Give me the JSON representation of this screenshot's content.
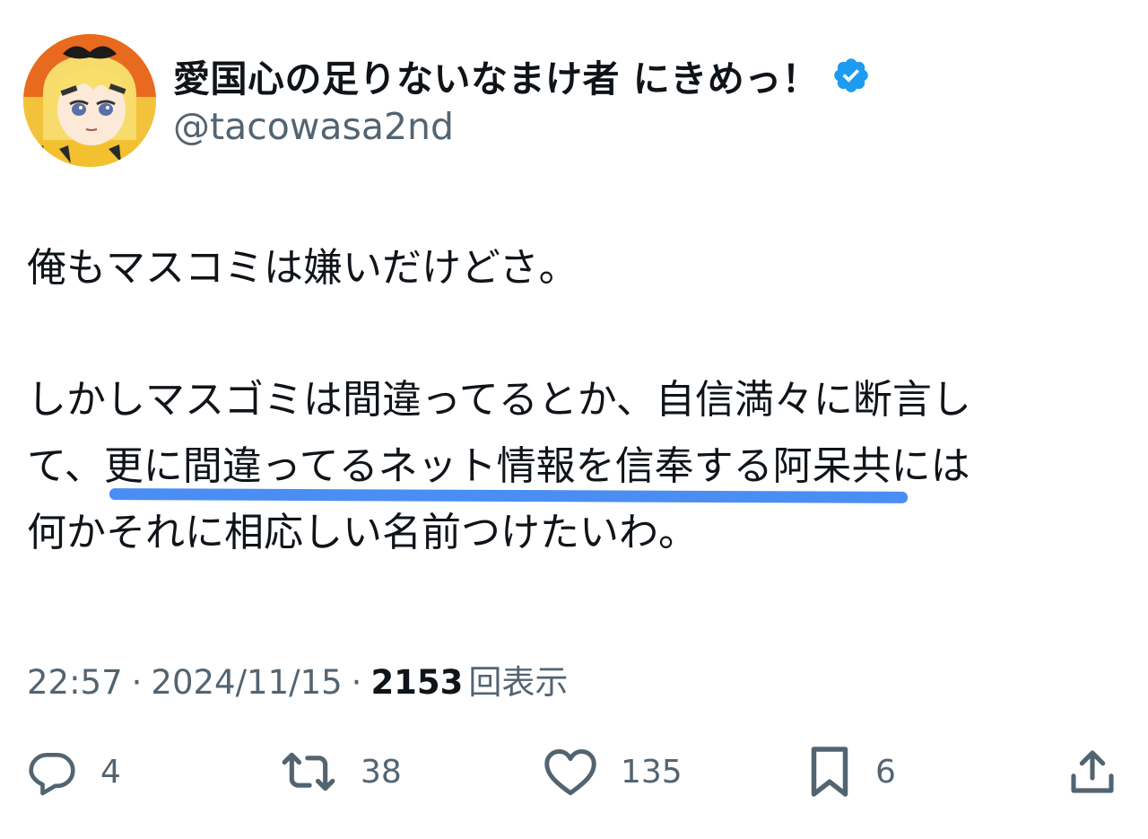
{
  "author": {
    "display_name": "愛国心の足りないなまけ者 にきめっ！",
    "handle": "@tacowasa2nd",
    "verified": true,
    "verified_color": "#1d9bf0"
  },
  "tweet": {
    "lines": {
      "l1": "俺もマスコミは嫌いだけどさ。",
      "l2": "しかしマスゴミは間違ってるとか、自信満々に断言し",
      "l3_pre": "て、",
      "l3_highlight": "更に間違ってるネット情報を信奉する阿呆共",
      "l3_post": "には",
      "l4": "何かそれに相応しい名前つけたいわ。"
    },
    "highlight_color": "#4a8ef3"
  },
  "meta": {
    "time": "22:57",
    "separator": "·",
    "date": "2024/11/15",
    "views_count": "2153",
    "views_label": "回表示"
  },
  "actions": {
    "reply_icon": "reply-icon",
    "reply_count": "4",
    "retweet_icon": "retweet-icon",
    "retweet_count": "38",
    "like_icon": "heart-icon",
    "like_count": "135",
    "bookmark_icon": "bookmark-icon",
    "bookmark_count": "6",
    "share_icon": "share-icon"
  },
  "colors": {
    "text_primary": "#0f1419",
    "text_secondary": "#536471",
    "avatar_bg": "#f6c331"
  }
}
